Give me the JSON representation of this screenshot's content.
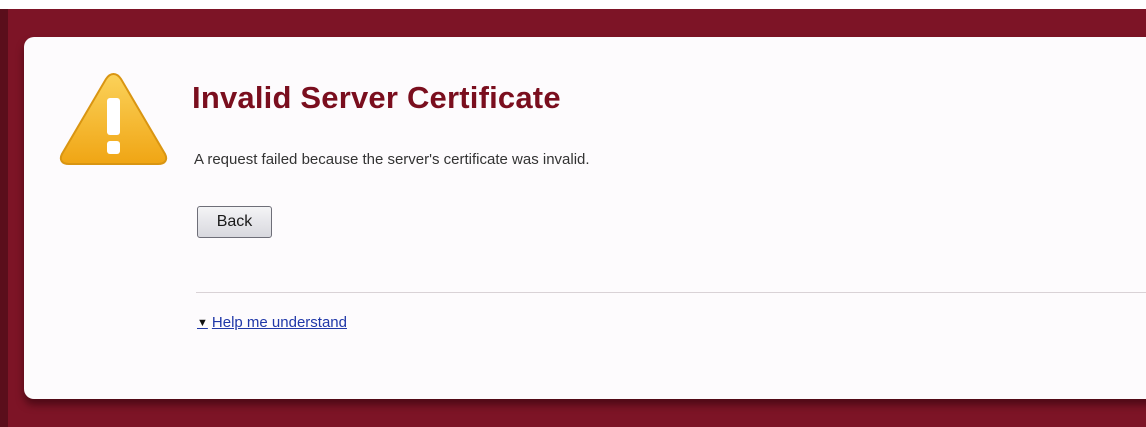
{
  "page": {
    "title": "Invalid Server Certificate",
    "message": "A request failed because the server's certificate was invalid.",
    "icon": "warning-icon"
  },
  "actions": {
    "back_label": "Back"
  },
  "help": {
    "arrow_icon": "triangle-down-icon",
    "link_label": "Help me understand"
  },
  "colors": {
    "frame": "#7d1426",
    "title": "#7a0e1e",
    "link": "#1f37a8",
    "warning": "#f5b51f"
  }
}
